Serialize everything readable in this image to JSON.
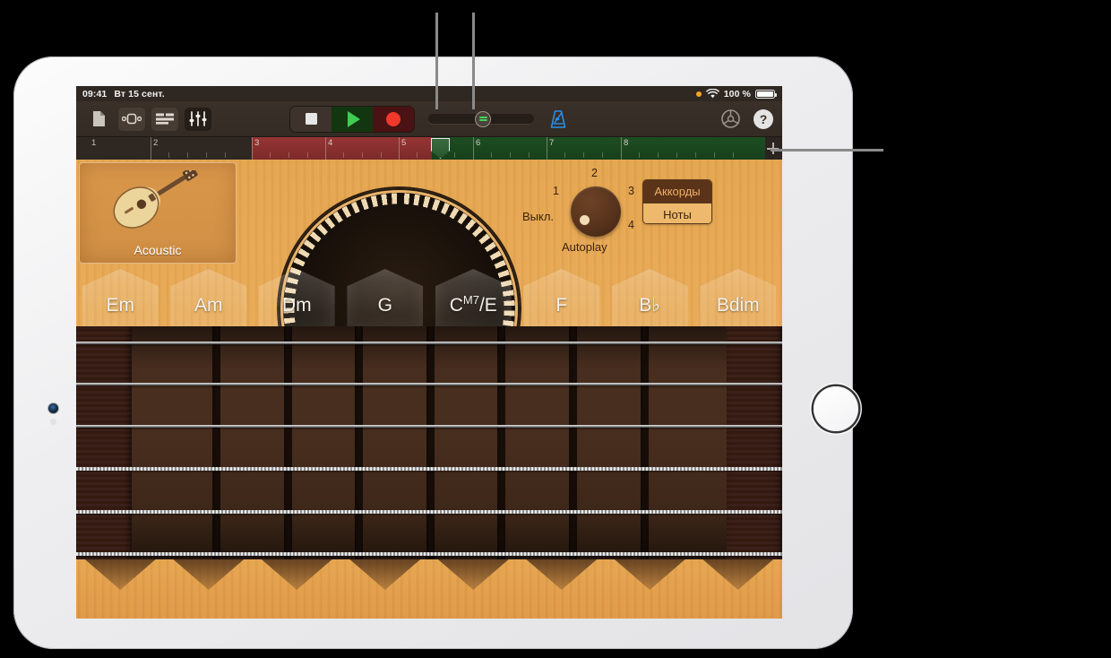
{
  "device": {
    "name": "ipad",
    "camera_icon": "camera-dot",
    "home_button_icon": "home-button-ring"
  },
  "statusbar": {
    "time": "09:41",
    "date": "Вт 15 сент.",
    "recording_dot": "orange-dot",
    "wifi_icon": "wifi-icon",
    "battery_percent": "100 %",
    "battery_icon": "battery-full-icon"
  },
  "toolbar": {
    "left_buttons": [
      {
        "name": "document-icon",
        "label": ""
      },
      {
        "name": "loop-browser-icon",
        "label": ""
      },
      {
        "name": "tracks-view-icon",
        "label": ""
      },
      {
        "name": "mixer-faders-icon",
        "label": ""
      }
    ],
    "transport": {
      "stop_label": "stop-icon",
      "play_label": "play-icon",
      "record_label": "record-icon"
    },
    "volume_slider": {
      "name": "master-slider",
      "knob_icon": "lcd-display-icon",
      "value_position_pct": 45
    },
    "metronome_icon": "metronome-icon",
    "settings_icon": "gear-icon",
    "help_label": "?"
  },
  "ruler": {
    "measures": [
      "1",
      "2",
      "3",
      "4",
      "5",
      "6",
      "7",
      "8"
    ],
    "add_section_icon": "plus-icon",
    "playhead_position_measure": "5.5",
    "segments": [
      {
        "name": "empty-section",
        "from": 1,
        "to": 3,
        "color": "#2e2722"
      },
      {
        "name": "red-section",
        "from": 3,
        "to": 5.5,
        "color": "#963434"
      },
      {
        "name": "green-section",
        "from": 5.5,
        "to": 8.2,
        "color": "#1e4d22"
      }
    ]
  },
  "instrument": {
    "card_label": "Acoustic",
    "icon": "acoustic-guitar-icon"
  },
  "autoplay": {
    "title": "Autoplay",
    "off_label": "Выкл.",
    "positions": [
      "1",
      "2",
      "3",
      "4"
    ],
    "selected": "Выкл."
  },
  "mode_toggle": {
    "chords_label": "Аккорды",
    "notes_label": "Ноты",
    "selected": "Аккорды"
  },
  "chords": [
    {
      "root": "Em",
      "sup": "",
      "bass": ""
    },
    {
      "root": "Am",
      "sup": "",
      "bass": ""
    },
    {
      "root": "Dm",
      "sup": "",
      "bass": ""
    },
    {
      "root": "G",
      "sup": "",
      "bass": ""
    },
    {
      "root": "C",
      "sup": "M7",
      "bass": "/E"
    },
    {
      "root": "F",
      "sup": "",
      "bass": ""
    },
    {
      "root": "B♭",
      "sup": "",
      "bass": ""
    },
    {
      "root": "Bdim",
      "sup": "",
      "bass": ""
    }
  ],
  "fretboard": {
    "string_count": 6,
    "fret_count": 7
  },
  "callouts": [
    {
      "name": "callout-play-button"
    },
    {
      "name": "callout-record-button"
    },
    {
      "name": "callout-ruler"
    }
  ],
  "colors": {
    "accent_green": "#3fcc52",
    "accent_red": "#f0392b",
    "wood": "#e6a54e",
    "toolbar_bg": "#3a3029",
    "blue_icon": "#2b8fe8"
  }
}
